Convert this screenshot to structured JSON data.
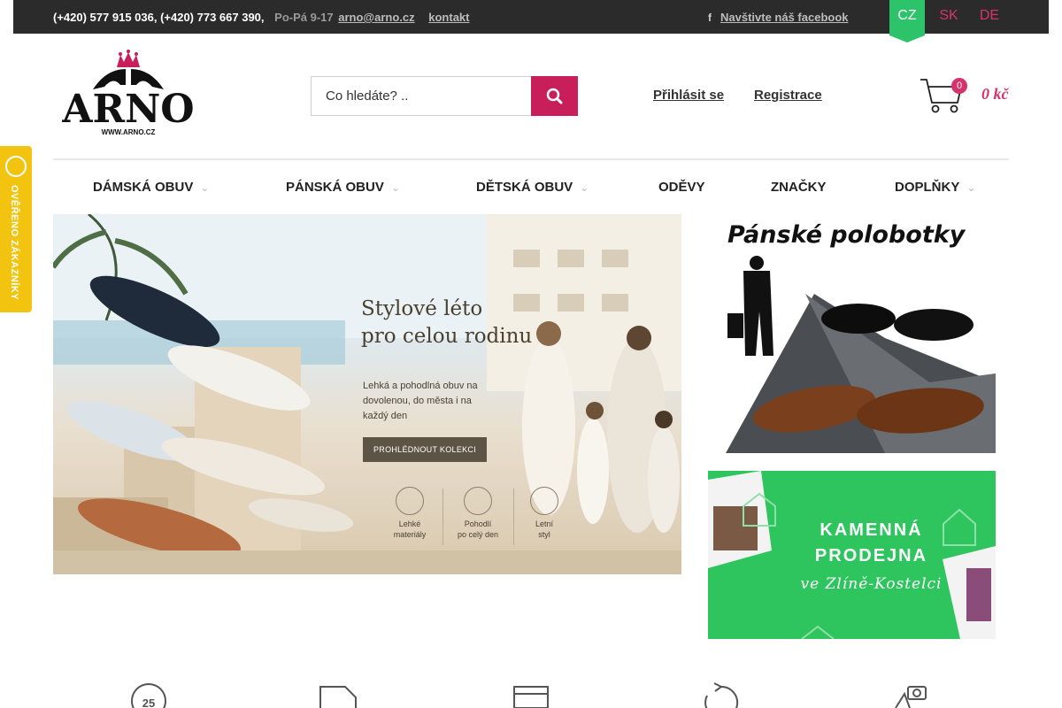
{
  "topbar": {
    "phones": "(+420) 577 915 036, (+420) 773 667 390,",
    "hours": "Po-Pá 9-17",
    "email": "arno@arno.cz",
    "contact_link": "kontakt",
    "facebook_link": "Navštivte náš facebook",
    "languages": [
      {
        "code": "CZ",
        "active": true
      },
      {
        "code": "SK",
        "active": false
      },
      {
        "code": "DE",
        "active": false
      }
    ]
  },
  "header": {
    "logo_text": "ARNO",
    "logo_url_text": "WWW.ARNO.CZ",
    "search_placeholder": "Co hledáte? ..",
    "login": "Přihlásit se",
    "register": "Registrace",
    "cart_count": "0",
    "cart_total": "0 kč"
  },
  "nav": [
    {
      "label": "DÁMSKÁ OBUV",
      "has_submenu": true
    },
    {
      "label": "PÁNSKÁ OBUV",
      "has_submenu": true
    },
    {
      "label": "DĚTSKÁ OBUV",
      "has_submenu": true
    },
    {
      "label": "ODĚVY",
      "has_submenu": false
    },
    {
      "label": "ZNAČKY",
      "has_submenu": false
    },
    {
      "label": "DOPLŇKY",
      "has_submenu": true
    }
  ],
  "verified_badge": "OVĚŘENO ZÁKAZNÍKY",
  "hero": {
    "headline_1": "Stylové léto",
    "headline_2": "pro celou rodinu",
    "subtext": "Lehká a pohodlná obuv na dovolenou, do města i na každý den",
    "cta": "PROHLÉDNOUT KOLEKCI",
    "features": [
      {
        "line1": "Lehké",
        "line2": "materiály"
      },
      {
        "line1": "Pohodlí",
        "line2": "po celý den"
      },
      {
        "line1": "Letní",
        "line2": "styl"
      }
    ]
  },
  "banners": {
    "men_half_shoes": "Pánské polobotky",
    "store_line1": "KAMENNÁ",
    "store_line2": "PRODEJNA",
    "store_line3": "ve Zlíně-Kostelci"
  },
  "services": {
    "delivery_days_icon_number": "25"
  },
  "colors": {
    "accent": "#c81f5a",
    "pink": "#d6336c",
    "green": "#2cc36b",
    "topbar": "#2b2b2b",
    "badge_yellow": "#f2c40f"
  }
}
